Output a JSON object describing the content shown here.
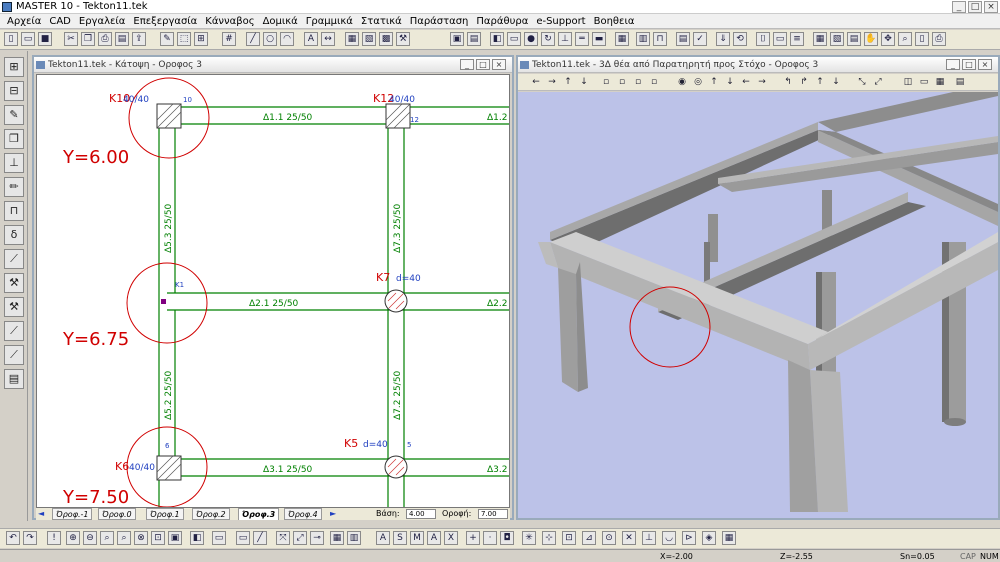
{
  "app": {
    "title": "MASTER 10 - Tekton11.tek"
  },
  "menu": [
    "Αρχεία",
    "CAD",
    "Εργαλεία",
    "Επεξεργασία",
    "Κάνναβος",
    "Δομικά",
    "Γραμμικά",
    "Στατικά",
    "Παράσταση",
    "Παράθυρα",
    "e-Support",
    "Βοηθεια"
  ],
  "plan_window": {
    "title": "Tekton11.tek - Κάτοψη - Οροφος 3",
    "columns": [
      {
        "label": "K10",
        "section": "40/40",
        "node": "10"
      },
      {
        "label": "K12",
        "section": "40/40",
        "node": "12"
      },
      {
        "label": "K7",
        "section": "d=40",
        "node": ""
      },
      {
        "label": "K5",
        "section": "d=40",
        "node": "5"
      },
      {
        "label": "K6",
        "section": "40/40",
        "node": "6"
      }
    ],
    "node_k1": "K1",
    "beams": [
      {
        "label": "Δ1.1  25/50"
      },
      {
        "label": "Δ1.2"
      },
      {
        "label": "Δ2.1  25/50"
      },
      {
        "label": "Δ2.2"
      },
      {
        "label": "Δ3.1  25/50"
      },
      {
        "label": "Δ3.2"
      },
      {
        "label": "Δ5.3  25/50"
      },
      {
        "label": "Δ5.2  25/50"
      },
      {
        "label": "Δ7.3  25/50"
      },
      {
        "label": "Δ7.2  25/50"
      }
    ],
    "annotations": [
      "Y=6.00",
      "Y=6.75",
      "Y=7.50"
    ],
    "floor_tabs": [
      "Όροφ.-1",
      "Όροφ.0",
      "Όροφ.1",
      "Όροφ.2",
      "Όροφ.3",
      "Όροφ.4"
    ],
    "active_tab": "Όροφ.3",
    "base_label": "Βάση:",
    "base_value": "4.00",
    "roof_label": "Οροφή:",
    "roof_value": "7.00"
  },
  "view3d_window": {
    "title": "Tekton11.tek - 3Δ θέα από Παρατηρητή προς Στόχο - Οροφος 3"
  },
  "status": {
    "x": "X=-2.00",
    "z": "Z=-2.55",
    "sn": "Sn=0.05",
    "caps": "CAP",
    "num": "NUM"
  },
  "colors": {
    "beam": "#008000",
    "label_red": "#d00000",
    "column_blue": "#2040c0",
    "bg3d": "#bcc2e8"
  },
  "icons": [
    "new-icon",
    "open-icon",
    "save-icon",
    "print-icon",
    "zoom-in-icon",
    "zoom-out-icon",
    "pan-icon",
    "grid-icon",
    "layer-icon"
  ]
}
